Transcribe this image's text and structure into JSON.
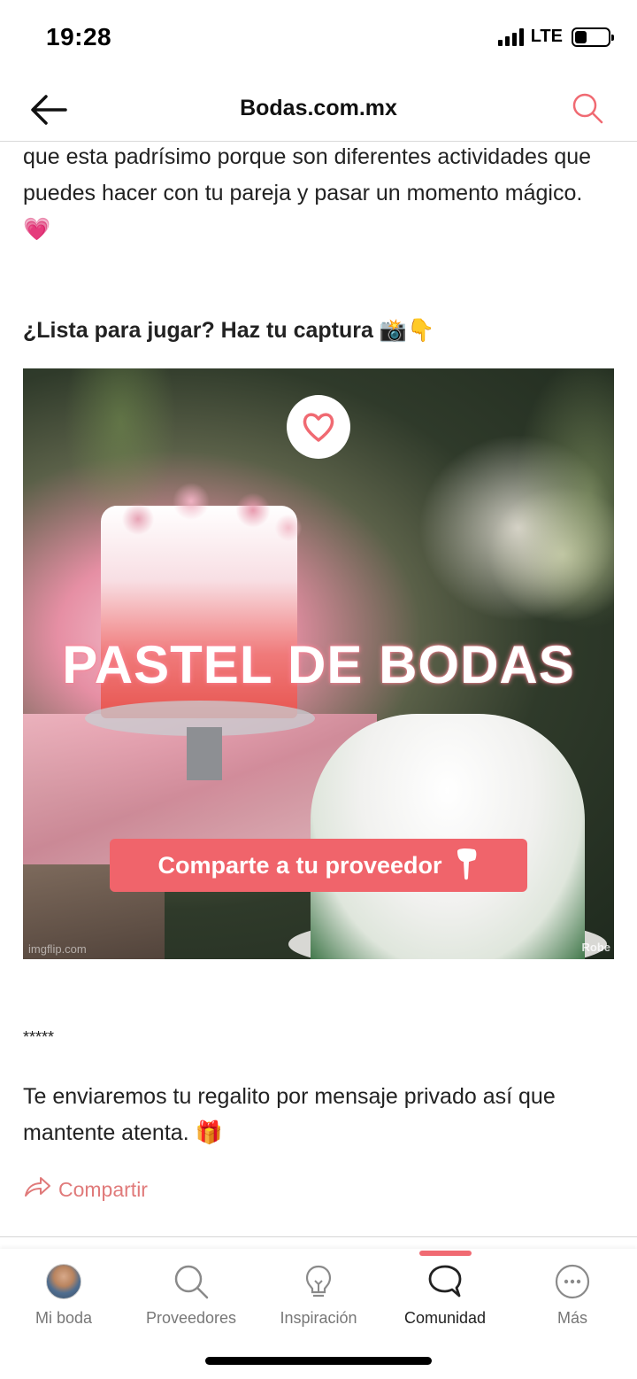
{
  "status": {
    "time": "19:28",
    "network": "LTE",
    "battery_level": 0.35
  },
  "nav": {
    "title": "Bodas.com.mx",
    "back_icon": "arrow-left-icon",
    "search_icon": "search-icon"
  },
  "post": {
    "paragraph1": "que esta padrísimo porque son diferentes actividades que puedes hacer con tu pareja y pasar un momento mágico. 💗",
    "prompt": "¿Lista para jugar? Haz tu captura 📸👇",
    "image": {
      "title": "PASTEL DE BODAS",
      "button_label": "Comparte a tu proveedor",
      "watermark_left": "imgflip.com",
      "watermark_right": "Robe",
      "accent": "#f0646b"
    },
    "stars": "*****",
    "paragraph2": "Te enviaremos tu regalito por mensaje privado así que mantente atenta. 🎁",
    "share_label": "Compartir"
  },
  "colors": {
    "brand": "#f0646b",
    "share": "#e07a7a"
  },
  "tabs": [
    {
      "label": "Mi boda",
      "icon": "avatar-icon",
      "active": false
    },
    {
      "label": "Proveedores",
      "icon": "search-icon",
      "active": false
    },
    {
      "label": "Inspiración",
      "icon": "lightbulb-icon",
      "active": false
    },
    {
      "label": "Comunidad",
      "icon": "chat-bubble-icon",
      "active": true
    },
    {
      "label": "Más",
      "icon": "more-icon",
      "active": false
    }
  ]
}
